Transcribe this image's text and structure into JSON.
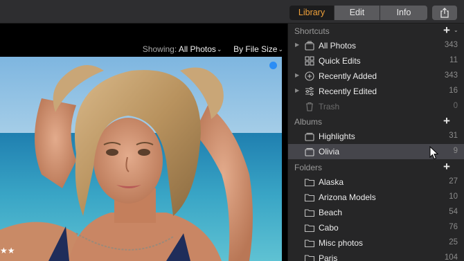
{
  "toolbar": {
    "tabs": [
      {
        "label": "Library",
        "active": true
      },
      {
        "label": "Edit",
        "active": false
      },
      {
        "label": "Info",
        "active": false
      }
    ],
    "share_icon": "share-icon",
    "accent_color": "#f0a13a"
  },
  "viewer": {
    "showing_label": "Showing:",
    "showing_value": "All Photos",
    "sort_value": "By File Size",
    "rating_stars": "★★"
  },
  "sidebar": {
    "shortcuts": {
      "title": "Shortcuts",
      "items": [
        {
          "label": "All Photos",
          "count": "343",
          "icon": "photos-stack-icon"
        },
        {
          "label": "Quick Edits",
          "count": "11",
          "icon": "grid-icon"
        },
        {
          "label": "Recently Added",
          "count": "343",
          "icon": "plus-circle-icon"
        },
        {
          "label": "Recently Edited",
          "count": "16",
          "icon": "sliders-icon"
        },
        {
          "label": "Trash",
          "count": "0",
          "icon": "trash-icon"
        }
      ]
    },
    "albums": {
      "title": "Albums",
      "items": [
        {
          "label": "Highlights",
          "count": "31",
          "icon": "album-icon"
        },
        {
          "label": "Olivia",
          "count": "9",
          "icon": "album-icon",
          "selected": true
        }
      ]
    },
    "folders": {
      "title": "Folders",
      "items": [
        {
          "label": "Alaska",
          "count": "27"
        },
        {
          "label": "Arizona Models",
          "count": "10"
        },
        {
          "label": "Beach",
          "count": "54"
        },
        {
          "label": "Cabo",
          "count": "76"
        },
        {
          "label": "Misc photos",
          "count": "25"
        },
        {
          "label": "Paris",
          "count": "104"
        }
      ]
    }
  }
}
